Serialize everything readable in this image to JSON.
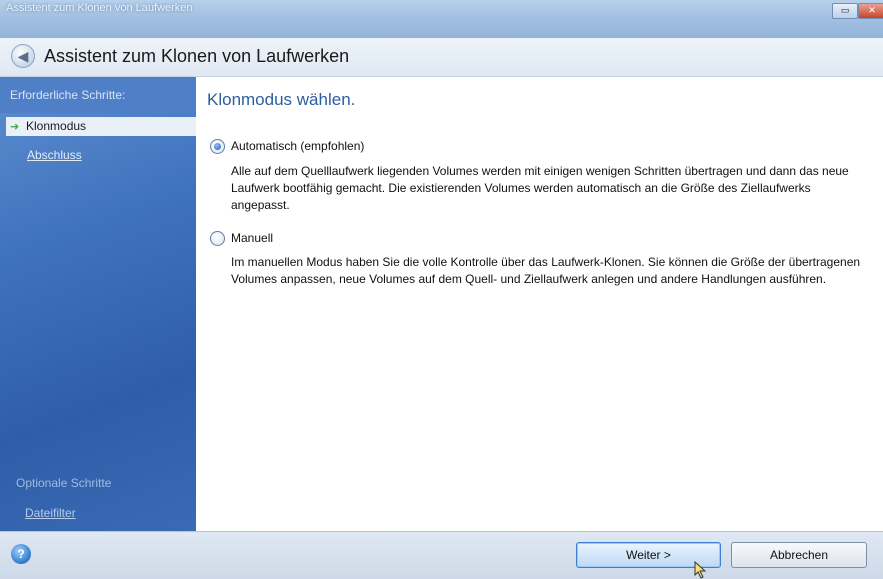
{
  "window": {
    "title": "Assistent zum Klonen von Laufwerken",
    "minmax_glyph": "▭",
    "close_glyph": "✕"
  },
  "header": {
    "back_icon": "◀",
    "title": "Assistent zum Klonen von Laufwerken"
  },
  "sidebar": {
    "heading": "Erforderliche Schritte:",
    "active_item": "Klonmodus",
    "active_arrow": "➜",
    "links": [
      {
        "label": "Abschluss"
      }
    ],
    "optional_heading": "Optionale Schritte",
    "optional_links": [
      {
        "label": "Dateifilter"
      }
    ]
  },
  "main": {
    "title": "Klonmodus wählen.",
    "options": [
      {
        "label": "Automatisch (empfohlen)",
        "checked": true,
        "description": "Alle auf dem Quelllaufwerk liegenden Volumes werden mit einigen wenigen Schritten übertragen und dann das neue Laufwerk bootfähig gemacht. Die existierenden Volumes werden automatisch an die Größe des Ziellaufwerks angepasst."
      },
      {
        "label": "Manuell",
        "checked": false,
        "description": "Im manuellen Modus haben Sie die volle Kontrolle über das Laufwerk-Klonen. Sie können die Größe der übertragenen Volumes anpassen, neue Volumes auf dem Quell- und Ziellaufwerk anlegen und andere Handlungen ausführen."
      }
    ]
  },
  "footer": {
    "help_icon": "?",
    "next_label": "Weiter >",
    "cancel_label": "Abbrechen"
  },
  "colors": {
    "sidebar": "#3f72bd",
    "title_blue": "#2c5ea0",
    "accent_green": "#3cae4a"
  }
}
